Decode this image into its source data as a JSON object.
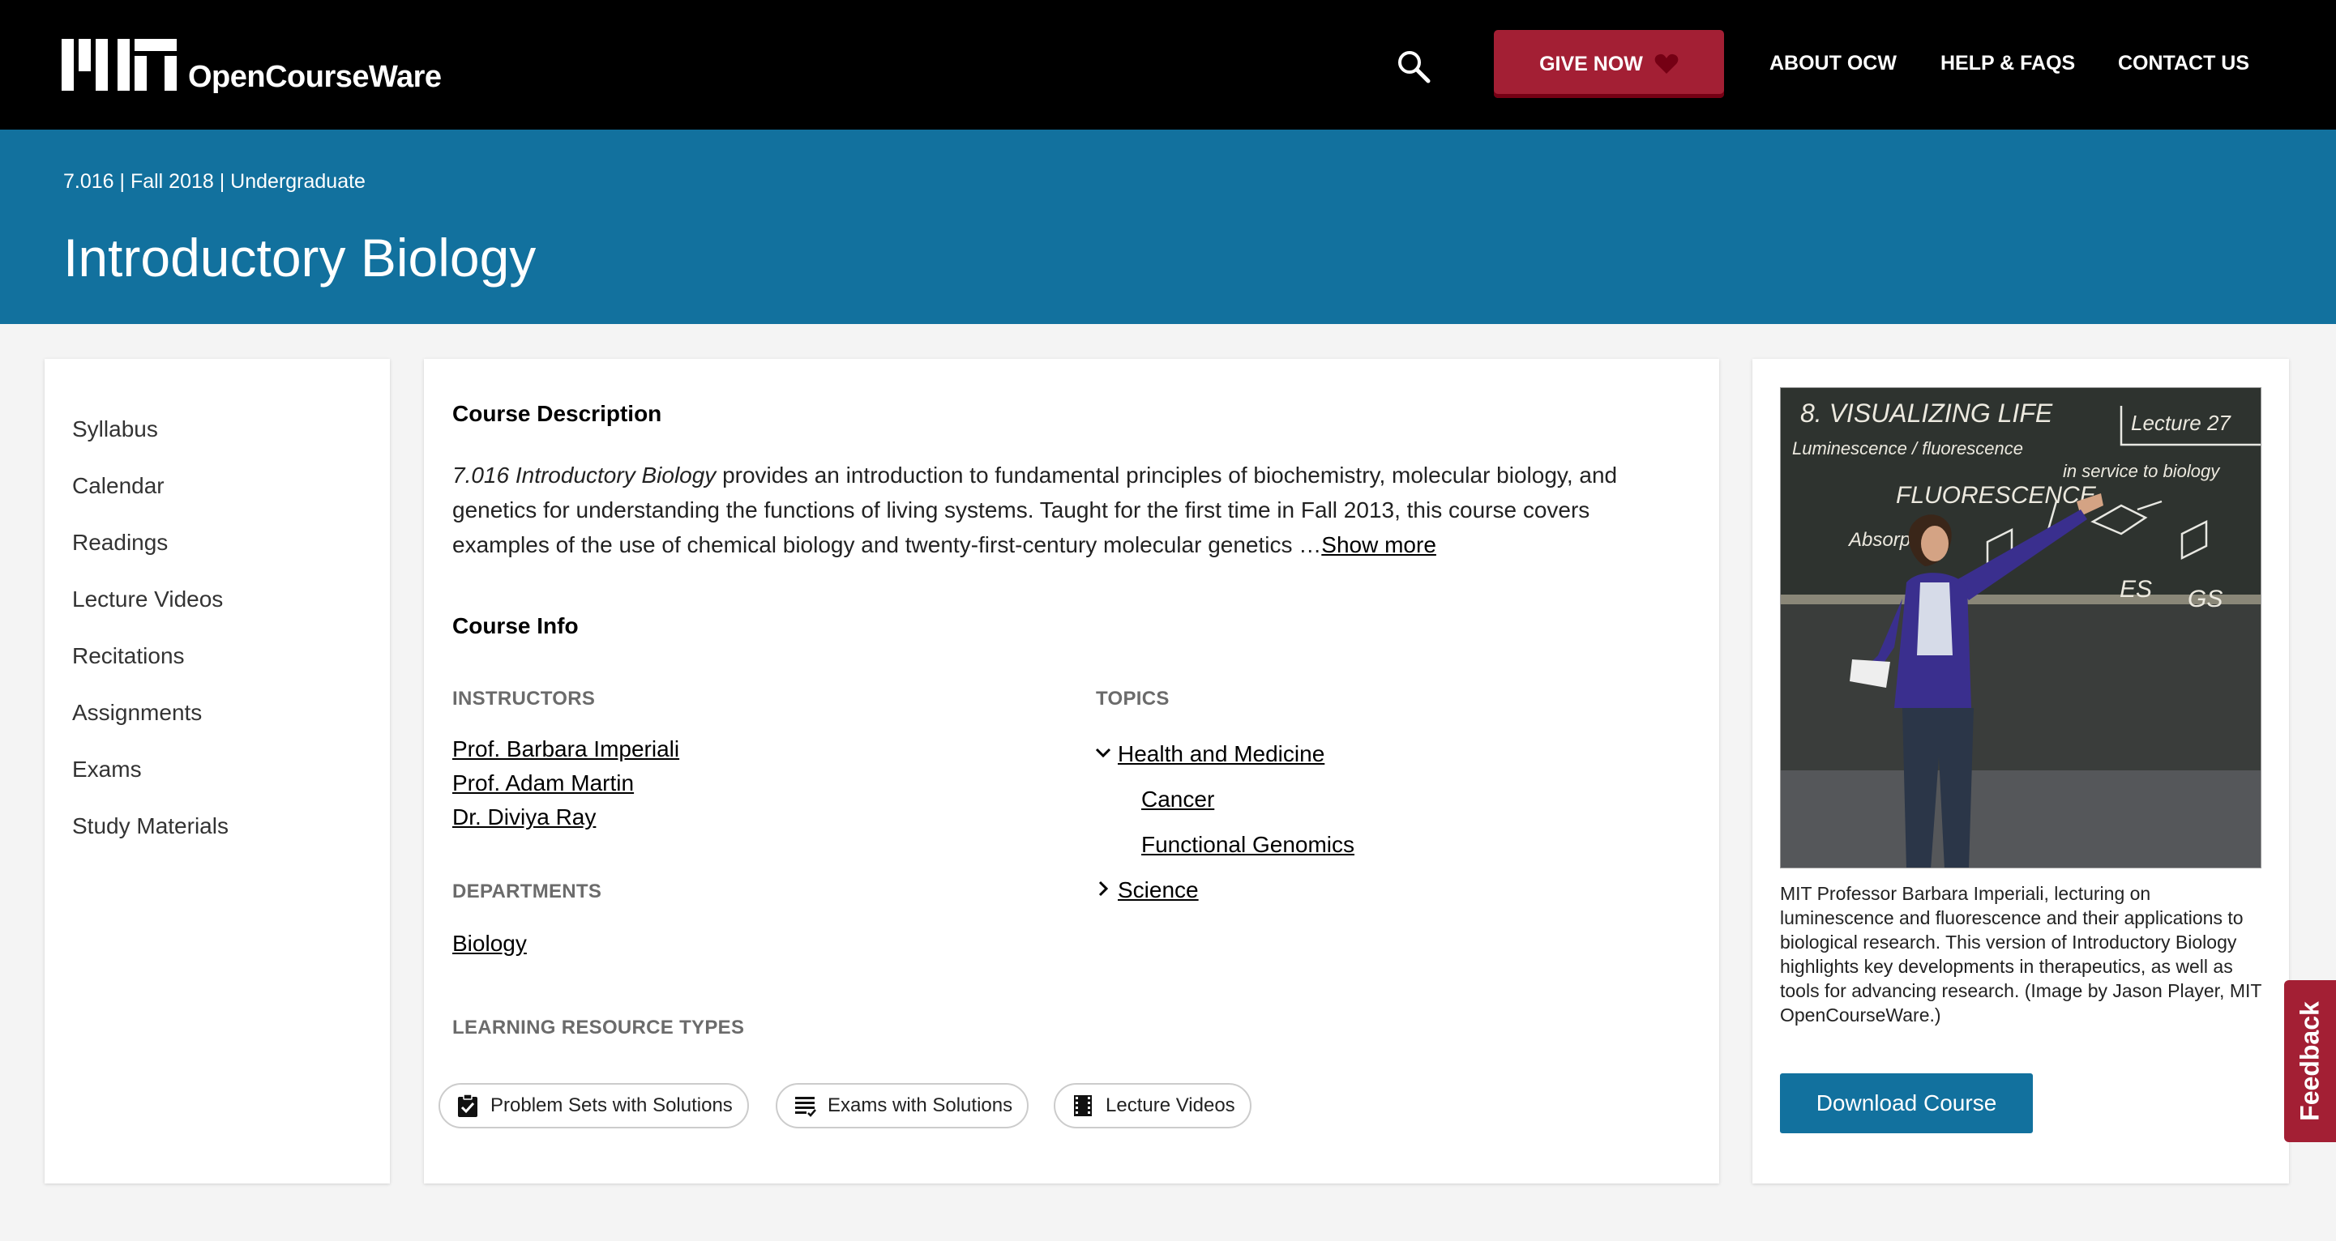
{
  "header": {
    "logo_text": "OpenCourseWare",
    "give_label": "GIVE NOW",
    "nav": [
      "ABOUT OCW",
      "HELP & FAQS",
      "CONTACT US"
    ],
    "colors": {
      "topbar": "#000000",
      "accent": "#a31f34",
      "banner": "#12719e"
    }
  },
  "course": {
    "meta": "7.016 | Fall 2018 | Undergraduate",
    "title": "Introductory Biology"
  },
  "sidebar": {
    "items": [
      "Syllabus",
      "Calendar",
      "Readings",
      "Lecture Videos",
      "Recitations",
      "Assignments",
      "Exams",
      "Study Materials"
    ]
  },
  "main": {
    "description_heading": "Course Description",
    "description_title": "7.016 Introductory Biology",
    "description_text": " provides an introduction to fundamental principles of biochemistry, molecular biology, and genetics for understanding the functions of living systems. Taught for the first time in Fall 2013, this course covers examples of the use of chemical biology and twenty-first-century molecular genetics …",
    "show_more": "Show more",
    "info_heading": "Course Info",
    "instructors_label": "INSTRUCTORS",
    "instructors": [
      "Prof. Barbara Imperiali",
      "Prof. Adam Martin",
      "Dr. Diviya Ray"
    ],
    "departments_label": "DEPARTMENTS",
    "departments": [
      "Biology"
    ],
    "topics_label": "TOPICS",
    "topics": {
      "expanded": "Health and Medicine",
      "children": [
        "Cancer",
        "Functional Genomics"
      ],
      "collapsed": "Science"
    },
    "lrt_label": "LEARNING RESOURCE TYPES",
    "resource_types": [
      {
        "label": "Problem Sets with Solutions",
        "icon": "clipboard-check-icon"
      },
      {
        "label": "Exams with Solutions",
        "icon": "list-icon"
      },
      {
        "label": "Lecture Videos",
        "icon": "film-icon"
      }
    ]
  },
  "right": {
    "image_text": {
      "title": "8. VISUALIZING LIFE",
      "lecture": "Lecture 27",
      "subtitle": "Luminescence / fluorescence",
      "subtitle2": "in service to biology",
      "word": "FLUORESCENCE",
      "absorption": "Absorption",
      "es": "ES",
      "gs": "GS"
    },
    "caption": "MIT Professor Barbara Imperiali, lecturing on luminescence and fluorescence and their applications to biological research. This version of Introductory Biology highlights key developments in therapeutics, as well as tools for advancing research. (Image by Jason Player, MIT OpenCourseWare.)",
    "download_label": "Download Course"
  },
  "feedback_label": "Feedback"
}
